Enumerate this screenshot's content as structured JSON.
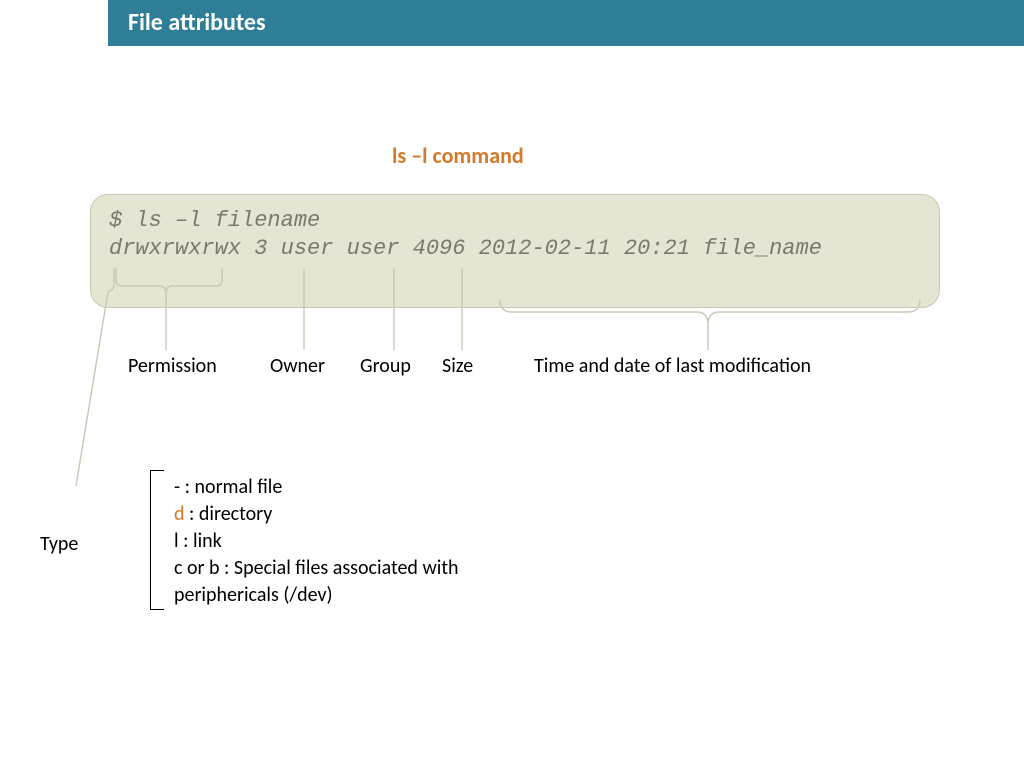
{
  "title": "File attributes",
  "subheading": "ls –l command",
  "code": {
    "line1": "$ ls –l filename",
    "line2": "drwxrwxrwx 3 user user 4096 2012-02-11 20:21 file_name"
  },
  "labels": {
    "permission": "Permission",
    "owner": "Owner",
    "group": "Group",
    "size": "Size",
    "mtime": "Time and date of last modification"
  },
  "type_section": {
    "heading": "Type",
    "items": {
      "dash_prefix": "- ",
      "dash_suffix": ": normal file",
      "d_prefix": "d",
      "d_suffix": " : directory",
      "l_line": "l : link",
      "cb_line": "c or b : Special files associated with periphericals (/dev)"
    }
  }
}
